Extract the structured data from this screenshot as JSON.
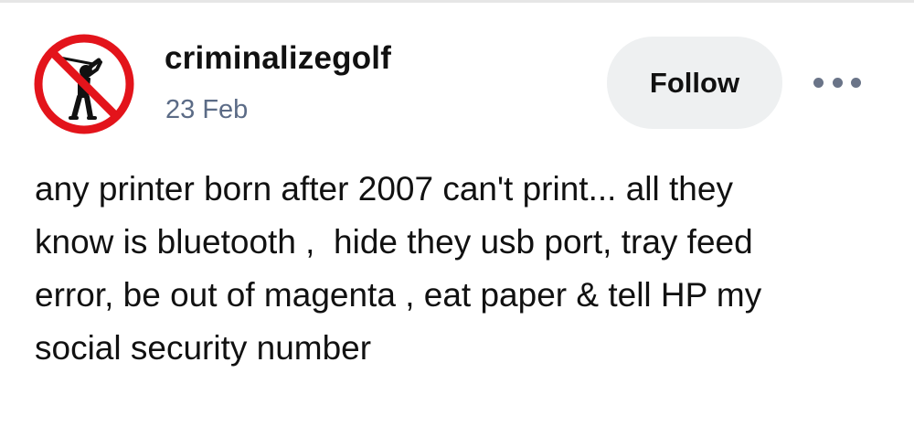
{
  "post": {
    "author": {
      "username": "criminalizegolf",
      "avatar_icon": "no-golf-icon"
    },
    "date": "23 Feb",
    "follow_label": "Follow",
    "more_icon": "more-horizontal-icon",
    "body_lines": [
      "any printer born after 2007 can't print... all they",
      "know is bluetooth ,  hide they usb port, tray feed",
      "error, be out of magenta , eat paper & tell HP my",
      "social security number"
    ]
  },
  "colors": {
    "prohibition_red": "#e3141b",
    "date_text": "#5b6b86",
    "follow_bg": "#eef0f1",
    "more_dots": "#6a7488"
  }
}
